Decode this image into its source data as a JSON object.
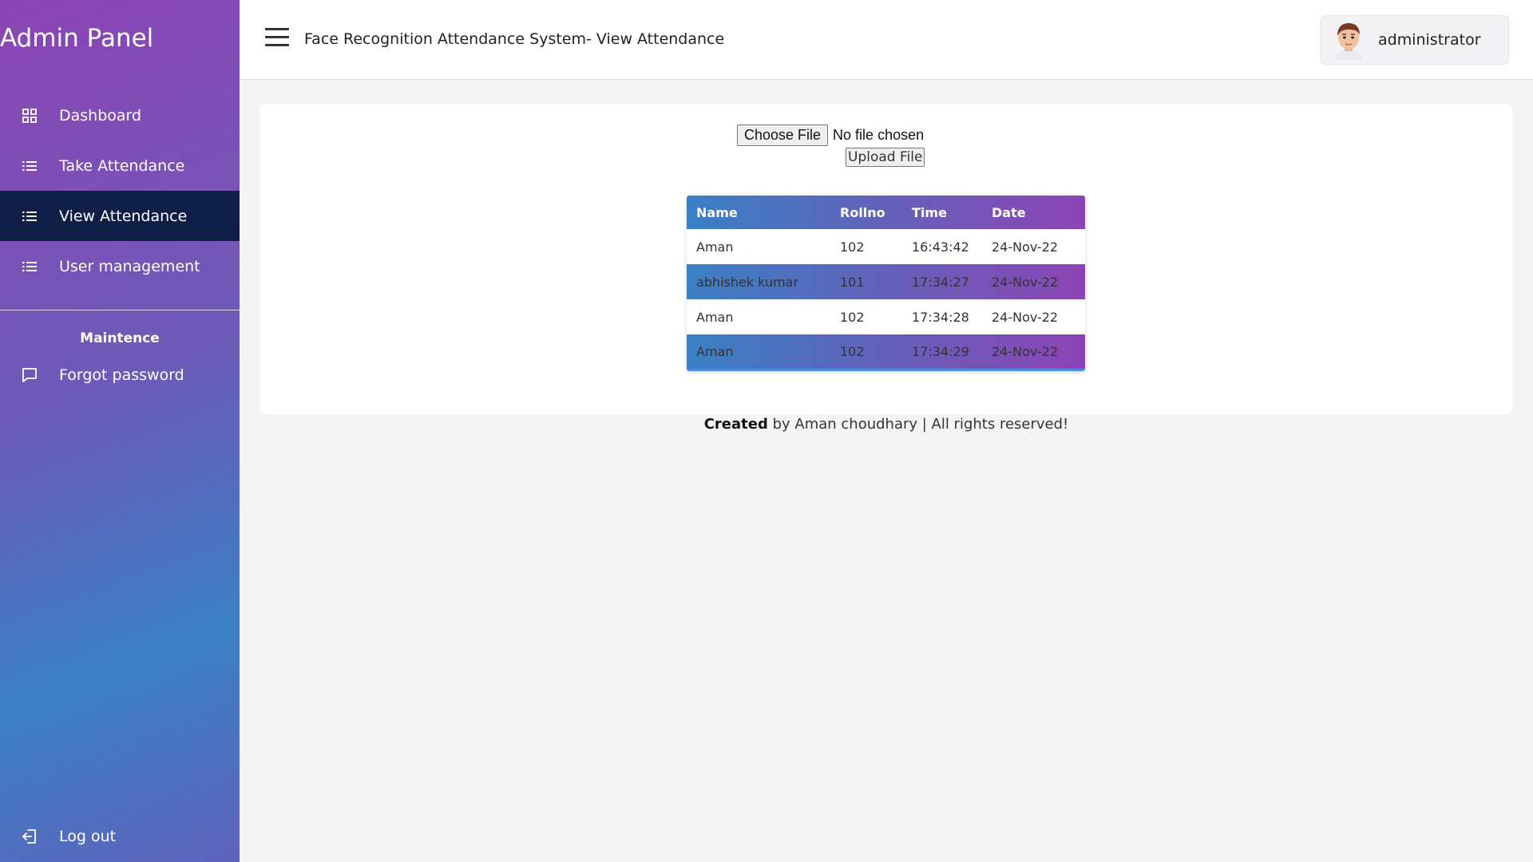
{
  "sidebar": {
    "brand": "Admin Panel",
    "items": [
      {
        "label": "Dashboard",
        "icon": "grid-icon"
      },
      {
        "label": "Take Attendance",
        "icon": "list-icon"
      },
      {
        "label": "View Attendance",
        "icon": "list-icon",
        "active": true
      },
      {
        "label": "User management",
        "icon": "list-icon"
      }
    ],
    "section_title": "Maintence",
    "section_items": [
      {
        "label": "Forgot password",
        "icon": "chat-icon"
      }
    ],
    "logout_label": "Log out"
  },
  "header": {
    "title": "Face Recognition Attendance System- View Attendance",
    "username": "administrator"
  },
  "upload": {
    "choose_label": "Choose File",
    "file_status": "No file chosen",
    "upload_label": "Upload File"
  },
  "table": {
    "columns": [
      "Name",
      "Rollno",
      "Time",
      "Date"
    ],
    "rows": [
      [
        "Aman",
        "102",
        "16:43:42",
        "24-Nov-22"
      ],
      [
        "abhishek kumar",
        "101",
        "17:34:27",
        "24-Nov-22"
      ],
      [
        "Aman",
        "102",
        "17:34:28",
        "24-Nov-22"
      ],
      [
        "Aman",
        "102",
        "17:34:29",
        "24-Nov-22"
      ]
    ]
  },
  "footer": {
    "bold": "Created",
    "text": " by Aman choudhary | All rights reserved!"
  },
  "colors": {
    "sidebar_gradient_start": "#8c44b4",
    "sidebar_gradient_end": "#3a80c4",
    "active_item": "#0f1e46",
    "page_bg": "#f4f4f4"
  }
}
